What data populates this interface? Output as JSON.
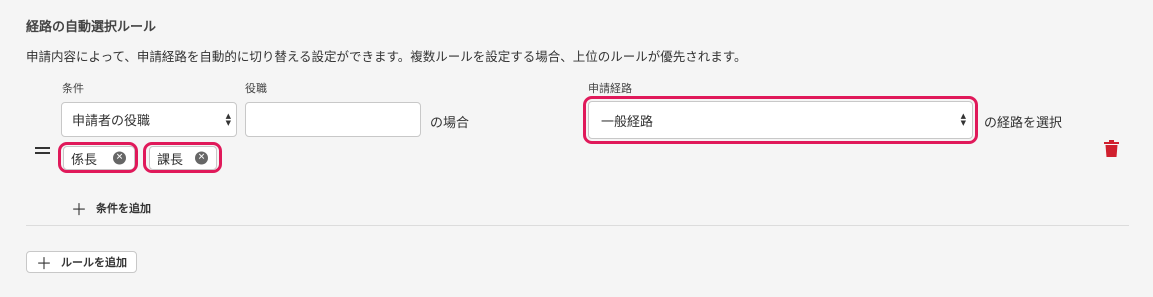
{
  "section": {
    "title": "経路の自動選択ルール",
    "description": "申請内容によって、申請経路を自動的に切り替える設定ができます。複数ルールを設定する場合、上位のルールが優先されます。"
  },
  "rule": {
    "condition_label": "条件",
    "condition_value": "申請者の役職",
    "role_label": "役職",
    "role_value": "",
    "case_text": "の場合",
    "route_label": "申請経路",
    "route_value": "一般経路",
    "route_suffix": "の経路を選択",
    "tags": [
      "係長",
      "課長"
    ],
    "add_condition": "条件を追加"
  },
  "add_rule": "ルールを追加",
  "colors": {
    "highlight": "#e0195a",
    "trash": "#d0202e"
  }
}
